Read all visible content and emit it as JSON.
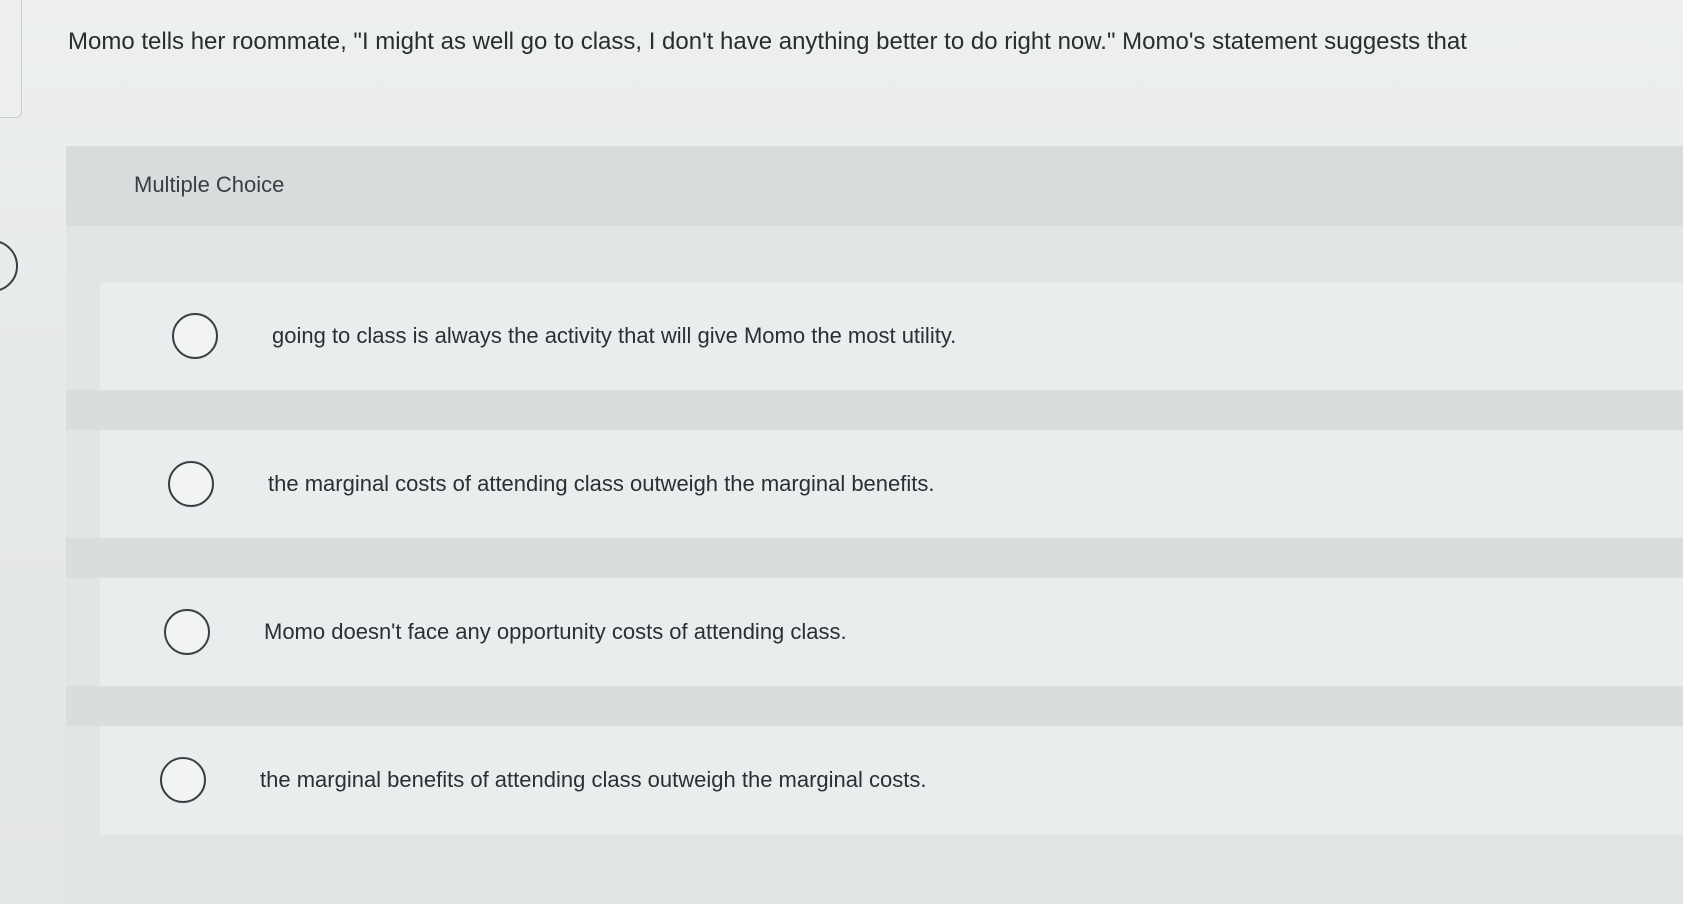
{
  "question": {
    "text": "Momo tells her roommate, \"I might as well go to class, I don't have anything better to do right now.\" Momo's statement suggests that"
  },
  "multiple_choice": {
    "title": "Multiple Choice",
    "options": [
      {
        "label": "going to class is always the activity that will give Momo the most utility.",
        "selected": false
      },
      {
        "label": "the marginal costs of attending class outweigh the marginal benefits.",
        "selected": false
      },
      {
        "label": "Momo doesn't face any opportunity costs of attending class.",
        "selected": false
      },
      {
        "label": "the marginal benefits of attending class outweigh the marginal costs.",
        "selected": false
      }
    ]
  }
}
